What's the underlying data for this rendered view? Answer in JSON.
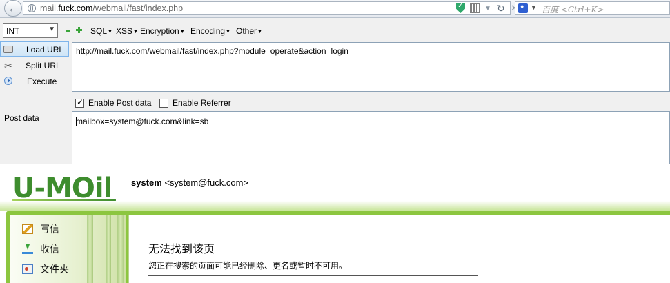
{
  "browser": {
    "url_prefix": "mail.",
    "url_domain": "fuck.com",
    "url_path": "/webmail/fast/index.php",
    "search_placeholder": "百度 <Ctrl+K>"
  },
  "hackbar": {
    "encoding_select": "INT",
    "menus": [
      "SQL",
      "XSS",
      "Encryption",
      "Encoding",
      "Other"
    ],
    "buttons": {
      "load_url": "Load URL",
      "split_url": "Split URL",
      "execute": "Execute"
    },
    "url_value": "http://mail.fuck.com/webmail/fast/index.php?module=operate&action=login",
    "enable_post_label": "Enable Post data",
    "enable_post_checked": true,
    "enable_referrer_label": "Enable Referrer",
    "enable_referrer_checked": false,
    "post_data_label": "Post data",
    "post_value": "mailbox=system@fuck.com&link=sb"
  },
  "webmail": {
    "logo_text": "U-MOil",
    "user_name": "system",
    "user_email": "<system@fuck.com>",
    "nav": [
      "写信",
      "收信",
      "文件夹"
    ],
    "error_title": "无法找到该页",
    "error_desc": "您正在搜索的页面可能已经删除、更名或暂时不可用。"
  },
  "colors": {
    "brand_green": "#3e8d2e",
    "frame_green": "#8cc63f",
    "hackbar_bg": "#f0f0f0"
  }
}
